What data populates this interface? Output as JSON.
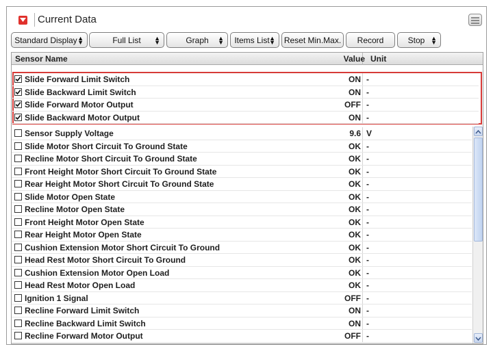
{
  "window": {
    "title": "Current Data"
  },
  "toolbar": {
    "buttons": [
      {
        "label": "Standard Display",
        "dropdown": true
      },
      {
        "label": "Full List",
        "dropdown": true
      },
      {
        "label": "Graph",
        "dropdown": true
      },
      {
        "label": "Items List",
        "dropdown": true
      },
      {
        "label": "Reset Min.Max.",
        "dropdown": false
      },
      {
        "label": "Record",
        "dropdown": false
      },
      {
        "label": "Stop",
        "dropdown": true
      }
    ]
  },
  "table": {
    "columns": {
      "name": "Sensor Name",
      "value": "Value",
      "unit": "Unit"
    },
    "highlighted_rows": [
      {
        "name": "Slide Forward Limit Switch",
        "value": "ON",
        "unit": "-",
        "checked": true
      },
      {
        "name": "Slide Backward Limit Switch",
        "value": "ON",
        "unit": "-",
        "checked": true
      },
      {
        "name": "Slide Forward Motor Output",
        "value": "OFF",
        "unit": "-",
        "checked": true
      },
      {
        "name": "Slide Backward Motor Output",
        "value": "ON",
        "unit": "-",
        "checked": true
      }
    ],
    "rows": [
      {
        "name": "Sensor Supply Voltage",
        "value": "9.6",
        "unit": "V",
        "checked": false
      },
      {
        "name": "Slide Motor Short Circuit To Ground State",
        "value": "OK",
        "unit": "-",
        "checked": false
      },
      {
        "name": "Recline Motor Short Circuit To Ground State",
        "value": "OK",
        "unit": "-",
        "checked": false
      },
      {
        "name": "Front Height Motor Short Circuit To Ground State",
        "value": "OK",
        "unit": "-",
        "checked": false
      },
      {
        "name": "Rear Height Motor Short Circuit To Ground State",
        "value": "OK",
        "unit": "-",
        "checked": false
      },
      {
        "name": "Slide Motor Open State",
        "value": "OK",
        "unit": "-",
        "checked": false
      },
      {
        "name": "Recline Motor Open State",
        "value": "OK",
        "unit": "-",
        "checked": false
      },
      {
        "name": "Front Height Motor Open State",
        "value": "OK",
        "unit": "-",
        "checked": false
      },
      {
        "name": "Rear Height Motor Open State",
        "value": "OK",
        "unit": "-",
        "checked": false
      },
      {
        "name": "Cushion Extension Motor Short Circuit To Ground",
        "value": "OK",
        "unit": "-",
        "checked": false
      },
      {
        "name": "Head Rest Motor Short Circuit To Ground",
        "value": "OK",
        "unit": "-",
        "checked": false
      },
      {
        "name": "Cushion Extension Motor Open Load",
        "value": "OK",
        "unit": "-",
        "checked": false
      },
      {
        "name": "Head Rest Motor Open Load",
        "value": "OK",
        "unit": "-",
        "checked": false
      },
      {
        "name": "Ignition 1 Signal",
        "value": "OFF",
        "unit": "-",
        "checked": false
      },
      {
        "name": "Recline Forward Limit Switch",
        "value": "ON",
        "unit": "-",
        "checked": false
      },
      {
        "name": "Recline Backward Limit Switch",
        "value": "ON",
        "unit": "-",
        "checked": false
      },
      {
        "name": "Recline Forward Motor Output",
        "value": "OFF",
        "unit": "-",
        "checked": false
      }
    ]
  },
  "colors": {
    "highlight_border": "#d63a37",
    "title_icon": "#e0312c"
  },
  "icons": {
    "title": "collapse-icon",
    "corner": "menu-icon",
    "scroll_up": "scroll-up-arrow-icon",
    "scroll_down": "scroll-down-arrow-icon"
  }
}
